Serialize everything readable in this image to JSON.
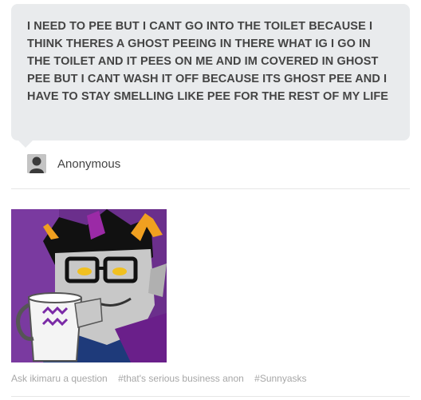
{
  "question": {
    "text": "I NEED TO PEE BUT I CANT GO INTO THE TOILET BECAUSE I THINK THERES A GHOST PEEING IN THERE WHAT IG I GO IN THE TOILET AND IT PEES ON ME AND IM COVERED IN GHOST PEE BUT I CANT WASH IT OFF BECAUSE ITS GHOST PEE AND I HAVE TO STAY SMELLING LIKE PEE FOR THE REST OF MY LIFE"
  },
  "asker": {
    "name": "Anonymous",
    "avatar_icon": "anonymous-silhouette-icon"
  },
  "post": {
    "image_description_icon": "character-with-mug-illustration"
  },
  "tags": {
    "ask_link": "Ask ikimaru a question",
    "items": [
      "#that's serious business anon",
      "#Sunnyasks"
    ]
  },
  "colors": {
    "bubble_bg": "#e9ebed",
    "text": "#444444",
    "tag_text": "#a7a7a7"
  }
}
